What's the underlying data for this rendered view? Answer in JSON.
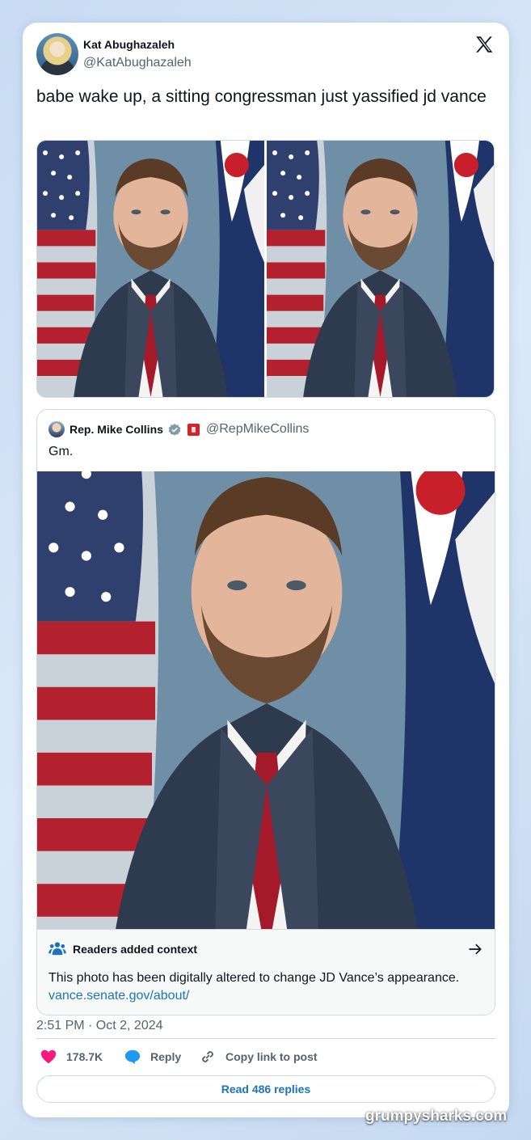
{
  "tweet": {
    "author_name": "Kat Abughazaleh",
    "author_handle": "@KatAbughazaleh",
    "text": "babe wake up, a sitting congressman just yassified jd vance",
    "timestamp": "2:51 PM · Oct 2, 2024"
  },
  "quoted": {
    "author_name": "Rep. Mike Collins",
    "author_handle": "@RepMikeCollins",
    "text": "Gm."
  },
  "context": {
    "title": "Readers added context",
    "body": "This photo has been digitally altered to change JD Vance’s appearance.",
    "link": "vance.senate.gov/about/"
  },
  "actions": {
    "likes": "178.7K",
    "reply": "Reply",
    "copy_link": "Copy link to post",
    "read_replies": "Read 486 replies"
  },
  "watermark": "grumpysharks.com",
  "colors": {
    "link": "#1d73b9",
    "like": "#f91880",
    "reply": "#1d9bf0"
  },
  "icons": [
    "x-logo-icon",
    "verified-icon",
    "readers-context-icon",
    "arrow-right-icon",
    "heart-icon",
    "reply-bubble-icon",
    "link-icon"
  ]
}
